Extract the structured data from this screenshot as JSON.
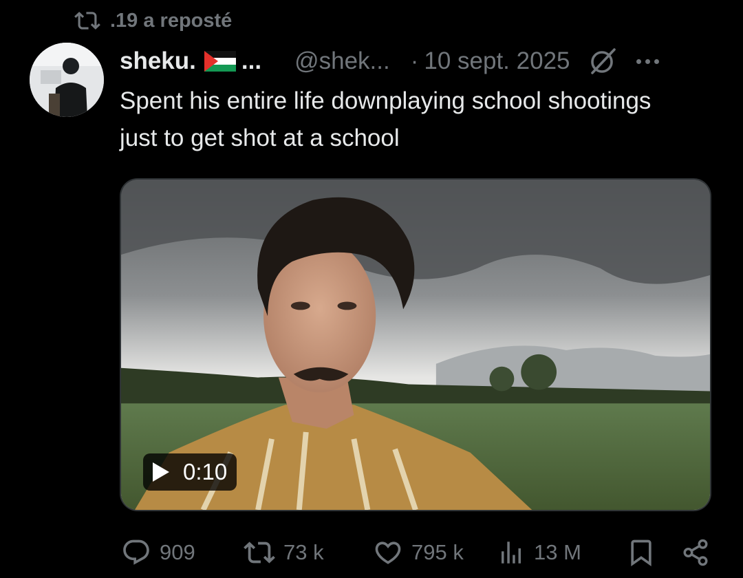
{
  "repost": {
    "icon": "repost-icon",
    "label": ".19 a reposté"
  },
  "tweet": {
    "author_name": "sheku.",
    "author_flag": "palestine-flag-emoji",
    "author_truncation": "...",
    "handle": "@shek...",
    "date": "10 sept. 2025",
    "separator": "·",
    "text": "Spent his entire life downplaying school shootings just to get shot at a school"
  },
  "media": {
    "type": "video",
    "duration": "0:10"
  },
  "actions": {
    "replies": "909",
    "reposts": "73 k",
    "likes": "795 k",
    "views": "13 M"
  },
  "colors": {
    "background": "#000000",
    "text": "#e7e9ea",
    "muted": "#71767b",
    "border": "#2f3336"
  }
}
